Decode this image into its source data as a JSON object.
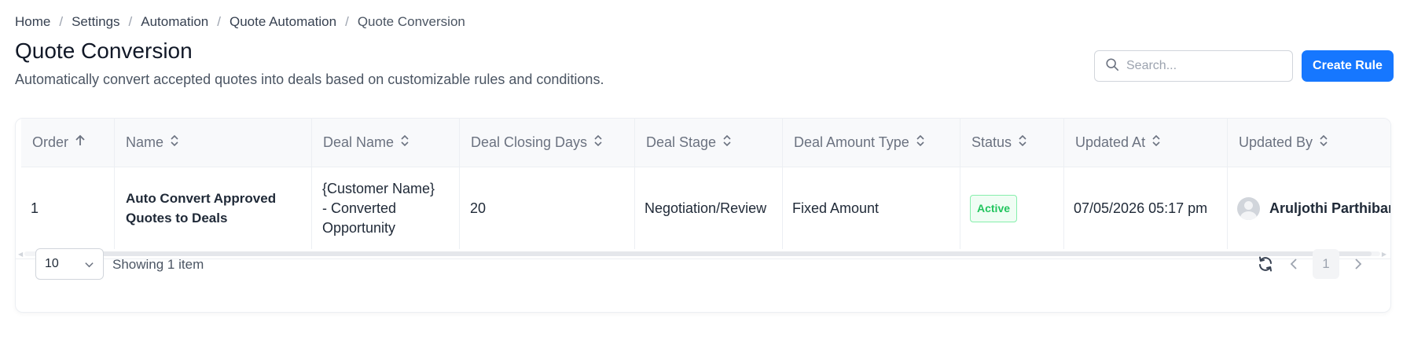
{
  "breadcrumb": {
    "items": [
      "Home",
      "Settings",
      "Automation",
      "Quote Automation",
      "Quote Conversion"
    ],
    "separator": "/"
  },
  "header": {
    "title": "Quote Conversion",
    "description": "Automatically convert accepted quotes into deals based on customizable rules and conditions."
  },
  "search": {
    "placeholder": "Search...",
    "value": ""
  },
  "actions": {
    "create_label": "Create Rule"
  },
  "table": {
    "columns": [
      {
        "label": "Order",
        "sort": "ascending"
      },
      {
        "label": "Name",
        "sort": "none"
      },
      {
        "label": "Deal Name",
        "sort": "none"
      },
      {
        "label": "Deal Closing Days",
        "sort": "none"
      },
      {
        "label": "Deal Stage",
        "sort": "none"
      },
      {
        "label": "Deal Amount Type",
        "sort": "none"
      },
      {
        "label": "Status",
        "sort": "none"
      },
      {
        "label": "Updated At",
        "sort": "none"
      },
      {
        "label": "Updated By",
        "sort": "none"
      }
    ],
    "rows": [
      {
        "order": "1",
        "name_line1": "Auto Convert Approved",
        "name_line2": "Quotes to Deals",
        "deal_name_line1": "{Customer Name}",
        "deal_name_line2": "- Converted",
        "deal_name_line3": "Opportunity",
        "deal_closing_days": "20",
        "deal_stage": "Negotiation/Review",
        "deal_amount_type": "Fixed Amount",
        "status": "Active",
        "updated_at": "07/05/2026 05:17 pm",
        "updated_by": "Aruljothi Parthiban"
      }
    ]
  },
  "pagination": {
    "page_size": "10",
    "showing_text": "Showing 1 item",
    "current_page": "1"
  },
  "colors": {
    "primary": "#1677ff",
    "status_active": "#22c55e"
  },
  "icons": [
    "search-icon",
    "sort-ascending-icon",
    "sort-icon",
    "chevron-down-icon",
    "refresh-icon",
    "chevron-left-icon",
    "chevron-right-icon",
    "user-avatar-icon"
  ]
}
